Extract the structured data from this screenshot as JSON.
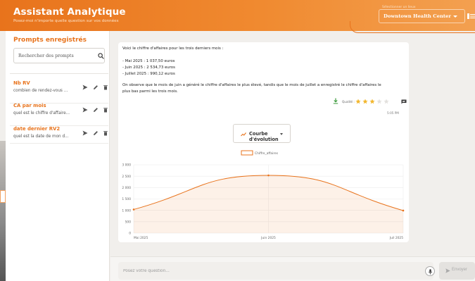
{
  "header": {
    "title": "Assistant Analytique",
    "subtitle": "Posez-moi n'importe quelle question sur vos données",
    "site_label": "Sélectionner un lieux",
    "site_value": "Downtown Health Center"
  },
  "sidebar": {
    "title": "Prompts enregistrés",
    "search_placeholder": "Rechercher des prompts",
    "prompts": [
      {
        "name": "Nb RV",
        "text": "combien de rendez-vous ..."
      },
      {
        "name": "CA par mois",
        "text": "quel est le chiffre d'affaire..."
      },
      {
        "name": "date dernier RV2",
        "text": "quel est la date de mon d..."
      }
    ]
  },
  "message": {
    "lines": [
      "Voici le chiffre d'affaires pour les trois derniers mois :",
      "- Mai 2025 : 1 037,50 euros",
      "- Juin 2025 : 2 534,73 euros",
      "- Juillet 2025 : 990,12 euros",
      "On observe que le mois de juin a généré le chiffre d'affaires le plus élevé, tandis que le mois de juillet a enregistré le chiffre d'affaires le",
      "plus bas parmi les trois mois."
    ],
    "rating_label": "Qualité :",
    "rating": 3,
    "rating_max": 5,
    "time": "5:05 PM"
  },
  "chart_selector": {
    "label": "Courbe d'évolution"
  },
  "chart_data": {
    "type": "area",
    "categories": [
      "Mai 2025",
      "Juin 2025",
      "Juil 2025"
    ],
    "series": [
      {
        "name": "Chiffre_affaires",
        "values": [
          1037.5,
          2534.73,
          990.12
        ]
      }
    ],
    "y_ticks": [
      "0",
      "500",
      "1 000",
      "1 500",
      "2 000",
      "2 500",
      "3 000"
    ],
    "ylim": [
      0,
      3000
    ],
    "legend": "top",
    "grid": true,
    "color": "#e8731c"
  },
  "input": {
    "placeholder": "Posez votre question...",
    "send_label": "Envoyer"
  },
  "colors": {
    "accent": "#e8731c"
  }
}
